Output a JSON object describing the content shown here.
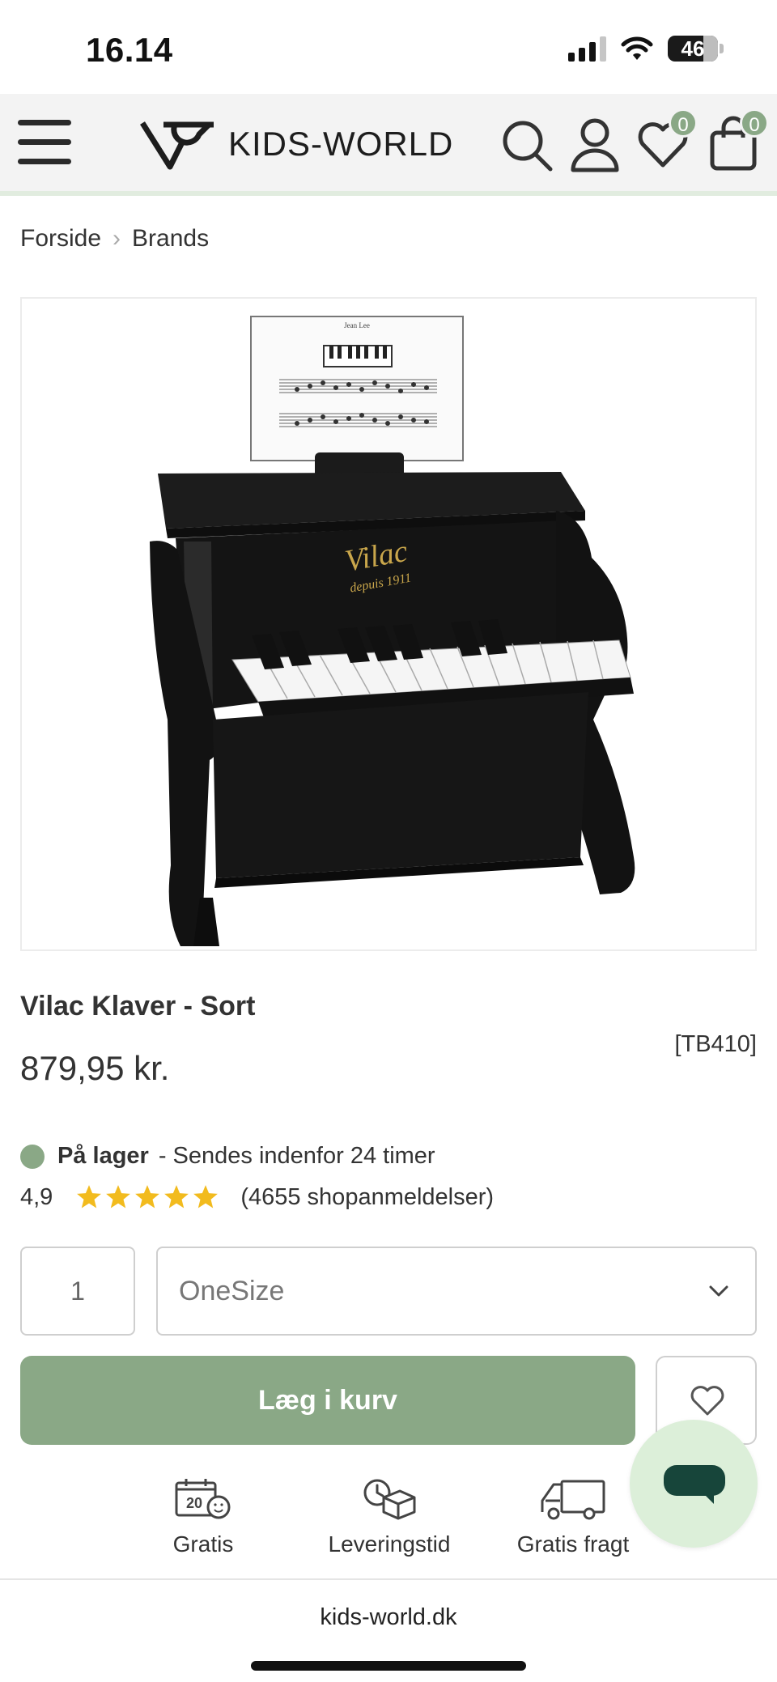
{
  "status_bar": {
    "time": "16.14",
    "battery": "46"
  },
  "header": {
    "logo_text": "KIDS-WORLD",
    "wishlist_count": "0",
    "cart_count": "0",
    "accent_color": "#8aa886"
  },
  "breadcrumb": {
    "items": [
      "Forside",
      "Brands"
    ]
  },
  "product": {
    "title": "Vilac Klaver - Sort",
    "sku": "[TB410]",
    "price": "879,95 kr.",
    "stock_label": "På lager",
    "stock_detail": "- Sendes indenfor 24 timer",
    "rating_value": "4,9",
    "rating_stars": 5,
    "reviews": "(4655 shopanmeldelser)",
    "sheet_music_title": "Jean Lee",
    "brand_mark": "Vilac",
    "brand_tagline": "depuis 1911"
  },
  "purchase": {
    "quantity": "1",
    "size_selected": "OneSize",
    "add_to_cart_label": "Læg i kurv"
  },
  "features": [
    {
      "icon": "calendar-20-smiley-icon",
      "label": "Gratis"
    },
    {
      "icon": "clock-box-icon",
      "label": "Leveringstid"
    },
    {
      "icon": "truck-icon",
      "label": "Gratis fragt"
    }
  ],
  "calendar_number": "20",
  "browser": {
    "url": "kids-world.dk"
  }
}
